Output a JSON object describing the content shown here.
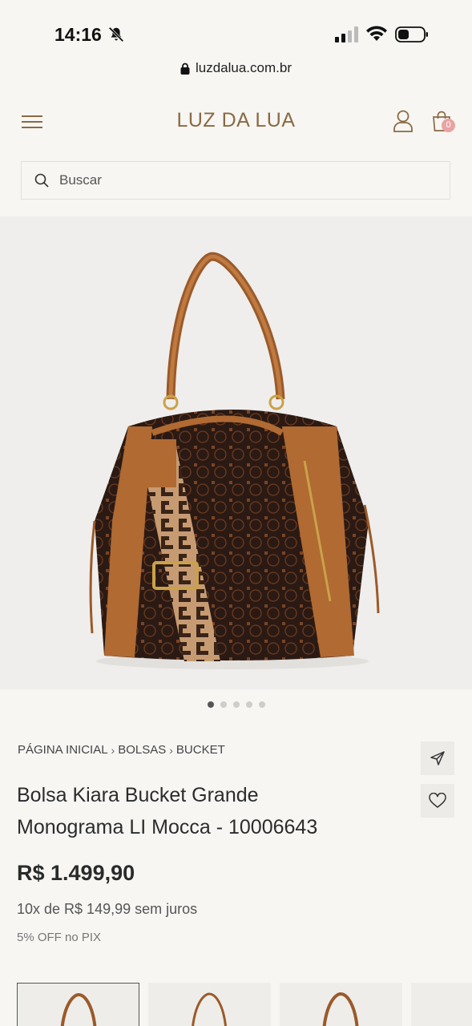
{
  "status_bar": {
    "time": "14:16"
  },
  "browser": {
    "url": "luzdalua.com.br"
  },
  "header": {
    "logo": "LUZ DA LUA",
    "cart_count": "0"
  },
  "search": {
    "placeholder": "Buscar"
  },
  "gallery": {
    "total_images": 5,
    "active_index": 0
  },
  "breadcrumb": {
    "items": [
      "PÁGINA INICIAL",
      "BOLSAS",
      "BUCKET"
    ]
  },
  "product": {
    "title_line1": "Bolsa Kiara Bucket Grande",
    "title_line2": "Monograma LI Mocca - 10006643",
    "price": "R$ 1.499,90",
    "installments": "10x de R$ 149,99 sem juros",
    "pix_discount": "5% OFF no PIX"
  },
  "icons": {
    "menu": "hamburger-menu-icon",
    "user": "user-icon",
    "cart": "shopping-bag-icon",
    "search": "search-icon",
    "share": "send-icon",
    "favorite": "heart-icon",
    "lock": "lock-icon"
  },
  "colors": {
    "brand": "#8a6a44",
    "background": "#f7f6f3",
    "cart_badge": "#e8a3a3",
    "bag_leather": "#b06a32",
    "bag_fabric": "#2b1a14"
  }
}
